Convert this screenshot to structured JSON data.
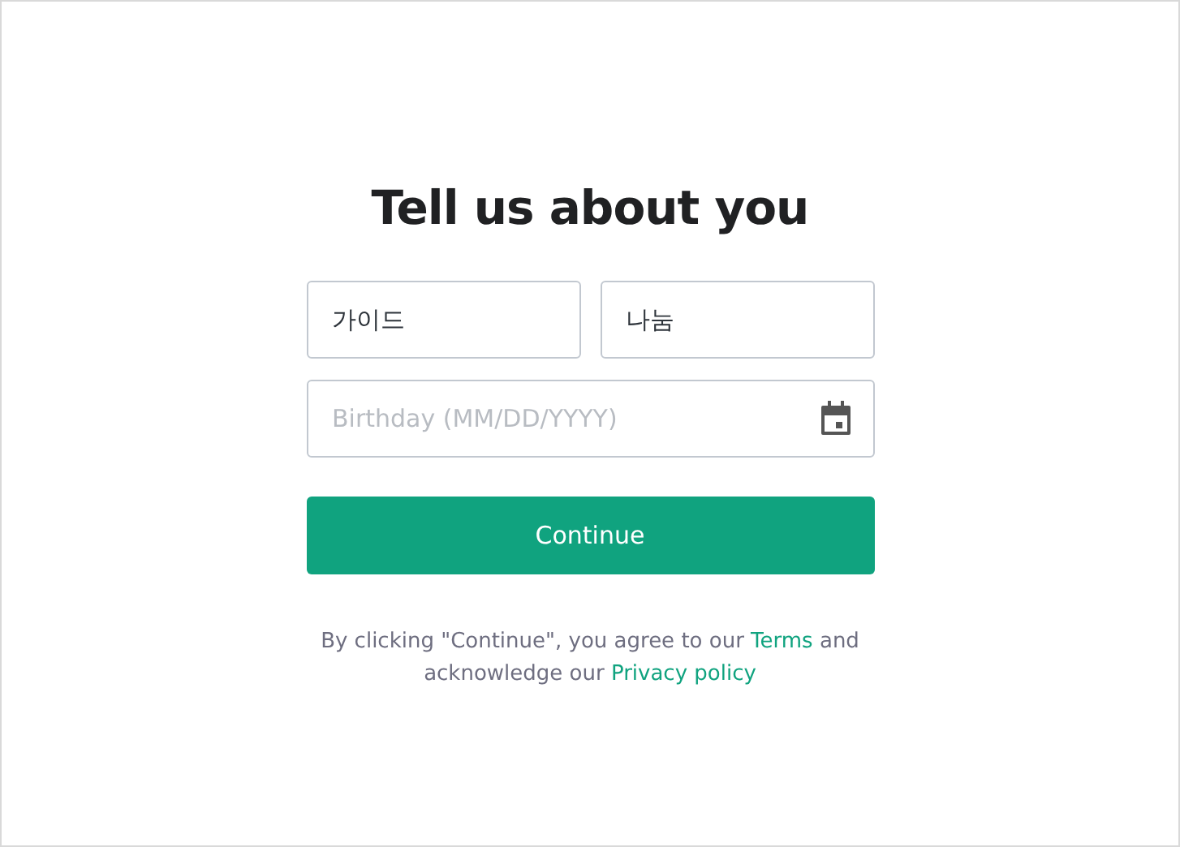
{
  "title": "Tell us about you",
  "fields": [
    {
      "value": "가이드"
    },
    {
      "value": "나눔"
    }
  ],
  "birthday": {
    "placeholder": "Birthday (MM/DD/YYYY)"
  },
  "continue_button": "Continue",
  "legal": {
    "before": "By clicking \"Continue\", you agree to our",
    "terms": "Terms",
    "middle": "and acknowledge our",
    "privacy": "Privacy policy"
  }
}
